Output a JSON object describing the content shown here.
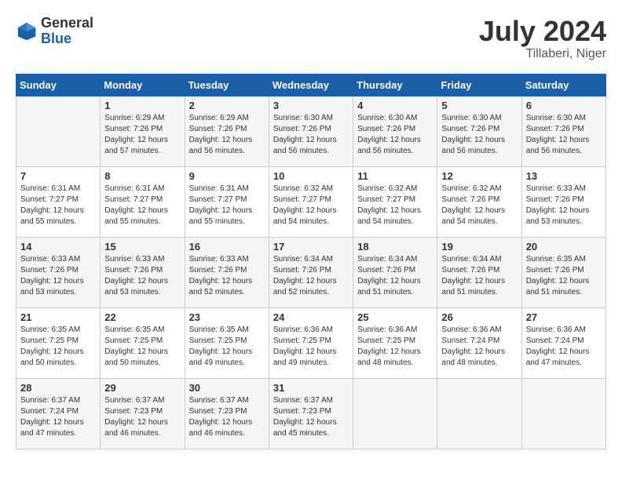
{
  "header": {
    "logo_general": "General",
    "logo_blue": "Blue",
    "month_year": "July 2024",
    "location": "Tillaberi, Niger"
  },
  "days_of_week": [
    "Sunday",
    "Monday",
    "Tuesday",
    "Wednesday",
    "Thursday",
    "Friday",
    "Saturday"
  ],
  "weeks": [
    [
      {
        "day": "",
        "sunrise": "",
        "sunset": "",
        "daylight": ""
      },
      {
        "day": "1",
        "sunrise": "Sunrise: 6:29 AM",
        "sunset": "Sunset: 7:26 PM",
        "daylight": "Daylight: 12 hours and 57 minutes."
      },
      {
        "day": "2",
        "sunrise": "Sunrise: 6:29 AM",
        "sunset": "Sunset: 7:26 PM",
        "daylight": "Daylight: 12 hours and 56 minutes."
      },
      {
        "day": "3",
        "sunrise": "Sunrise: 6:30 AM",
        "sunset": "Sunset: 7:26 PM",
        "daylight": "Daylight: 12 hours and 56 minutes."
      },
      {
        "day": "4",
        "sunrise": "Sunrise: 6:30 AM",
        "sunset": "Sunset: 7:26 PM",
        "daylight": "Daylight: 12 hours and 56 minutes."
      },
      {
        "day": "5",
        "sunrise": "Sunrise: 6:30 AM",
        "sunset": "Sunset: 7:26 PM",
        "daylight": "Daylight: 12 hours and 56 minutes."
      },
      {
        "day": "6",
        "sunrise": "Sunrise: 6:30 AM",
        "sunset": "Sunset: 7:26 PM",
        "daylight": "Daylight: 12 hours and 56 minutes."
      }
    ],
    [
      {
        "day": "7",
        "sunrise": "Sunrise: 6:31 AM",
        "sunset": "Sunset: 7:27 PM",
        "daylight": "Daylight: 12 hours and 55 minutes."
      },
      {
        "day": "8",
        "sunrise": "Sunrise: 6:31 AM",
        "sunset": "Sunset: 7:27 PM",
        "daylight": "Daylight: 12 hours and 55 minutes."
      },
      {
        "day": "9",
        "sunrise": "Sunrise: 6:31 AM",
        "sunset": "Sunset: 7:27 PM",
        "daylight": "Daylight: 12 hours and 55 minutes."
      },
      {
        "day": "10",
        "sunrise": "Sunrise: 6:32 AM",
        "sunset": "Sunset: 7:27 PM",
        "daylight": "Daylight: 12 hours and 54 minutes."
      },
      {
        "day": "11",
        "sunrise": "Sunrise: 6:32 AM",
        "sunset": "Sunset: 7:27 PM",
        "daylight": "Daylight: 12 hours and 54 minutes."
      },
      {
        "day": "12",
        "sunrise": "Sunrise: 6:32 AM",
        "sunset": "Sunset: 7:26 PM",
        "daylight": "Daylight: 12 hours and 54 minutes."
      },
      {
        "day": "13",
        "sunrise": "Sunrise: 6:33 AM",
        "sunset": "Sunset: 7:26 PM",
        "daylight": "Daylight: 12 hours and 53 minutes."
      }
    ],
    [
      {
        "day": "14",
        "sunrise": "Sunrise: 6:33 AM",
        "sunset": "Sunset: 7:26 PM",
        "daylight": "Daylight: 12 hours and 53 minutes."
      },
      {
        "day": "15",
        "sunrise": "Sunrise: 6:33 AM",
        "sunset": "Sunset: 7:26 PM",
        "daylight": "Daylight: 12 hours and 53 minutes."
      },
      {
        "day": "16",
        "sunrise": "Sunrise: 6:33 AM",
        "sunset": "Sunset: 7:26 PM",
        "daylight": "Daylight: 12 hours and 52 minutes."
      },
      {
        "day": "17",
        "sunrise": "Sunrise: 6:34 AM",
        "sunset": "Sunset: 7:26 PM",
        "daylight": "Daylight: 12 hours and 52 minutes."
      },
      {
        "day": "18",
        "sunrise": "Sunrise: 6:34 AM",
        "sunset": "Sunset: 7:26 PM",
        "daylight": "Daylight: 12 hours and 51 minutes."
      },
      {
        "day": "19",
        "sunrise": "Sunrise: 6:34 AM",
        "sunset": "Sunset: 7:26 PM",
        "daylight": "Daylight: 12 hours and 51 minutes."
      },
      {
        "day": "20",
        "sunrise": "Sunrise: 6:35 AM",
        "sunset": "Sunset: 7:26 PM",
        "daylight": "Daylight: 12 hours and 51 minutes."
      }
    ],
    [
      {
        "day": "21",
        "sunrise": "Sunrise: 6:35 AM",
        "sunset": "Sunset: 7:25 PM",
        "daylight": "Daylight: 12 hours and 50 minutes."
      },
      {
        "day": "22",
        "sunrise": "Sunrise: 6:35 AM",
        "sunset": "Sunset: 7:25 PM",
        "daylight": "Daylight: 12 hours and 50 minutes."
      },
      {
        "day": "23",
        "sunrise": "Sunrise: 6:35 AM",
        "sunset": "Sunset: 7:25 PM",
        "daylight": "Daylight: 12 hours and 49 minutes."
      },
      {
        "day": "24",
        "sunrise": "Sunrise: 6:36 AM",
        "sunset": "Sunset: 7:25 PM",
        "daylight": "Daylight: 12 hours and 49 minutes."
      },
      {
        "day": "25",
        "sunrise": "Sunrise: 6:36 AM",
        "sunset": "Sunset: 7:25 PM",
        "daylight": "Daylight: 12 hours and 48 minutes."
      },
      {
        "day": "26",
        "sunrise": "Sunrise: 6:36 AM",
        "sunset": "Sunset: 7:24 PM",
        "daylight": "Daylight: 12 hours and 48 minutes."
      },
      {
        "day": "27",
        "sunrise": "Sunrise: 6:36 AM",
        "sunset": "Sunset: 7:24 PM",
        "daylight": "Daylight: 12 hours and 47 minutes."
      }
    ],
    [
      {
        "day": "28",
        "sunrise": "Sunrise: 6:37 AM",
        "sunset": "Sunset: 7:24 PM",
        "daylight": "Daylight: 12 hours and 47 minutes."
      },
      {
        "day": "29",
        "sunrise": "Sunrise: 6:37 AM",
        "sunset": "Sunset: 7:23 PM",
        "daylight": "Daylight: 12 hours and 46 minutes."
      },
      {
        "day": "30",
        "sunrise": "Sunrise: 6:37 AM",
        "sunset": "Sunset: 7:23 PM",
        "daylight": "Daylight: 12 hours and 46 minutes."
      },
      {
        "day": "31",
        "sunrise": "Sunrise: 6:37 AM",
        "sunset": "Sunset: 7:23 PM",
        "daylight": "Daylight: 12 hours and 45 minutes."
      },
      {
        "day": "",
        "sunrise": "",
        "sunset": "",
        "daylight": ""
      },
      {
        "day": "",
        "sunrise": "",
        "sunset": "",
        "daylight": ""
      },
      {
        "day": "",
        "sunrise": "",
        "sunset": "",
        "daylight": ""
      }
    ]
  ]
}
